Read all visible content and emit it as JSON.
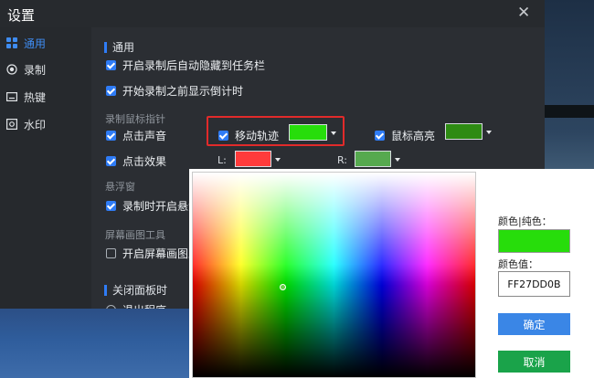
{
  "window": {
    "title": "设置",
    "close_glyph": "✕"
  },
  "sidebar": {
    "items": [
      {
        "label": "通用",
        "icon": "grid-icon",
        "active": true
      },
      {
        "label": "录制",
        "icon": "record-icon",
        "active": false
      },
      {
        "label": "热键",
        "icon": "keyboard-icon",
        "active": false
      },
      {
        "label": "水印",
        "icon": "watermark-icon",
        "active": false
      }
    ]
  },
  "general": {
    "section_title": "通用",
    "auto_hide": "开启录制后自动隐藏到任务栏",
    "countdown": "开始录制之前显示倒计时"
  },
  "mouse": {
    "group_title": "录制鼠标指针",
    "click_sound": "点击声音",
    "move_track": "移动轨迹",
    "highlight": "鼠标高亮",
    "click_effect": "点击效果",
    "left_label": "L:",
    "right_label": "R:"
  },
  "floating": {
    "group_title": "悬浮窗",
    "option": "录制时开启悬浮"
  },
  "drawing": {
    "group_title": "屏幕画图工具",
    "option": "开启屏幕画图工"
  },
  "close_panel": {
    "section_title": "关闭面板时",
    "option": "退出程序"
  },
  "colors": {
    "accent": "#2f7cf6",
    "move_track_swatch": "#27dd0b",
    "highlight_swatch": "#2e8b13",
    "left_click_swatch": "#ff3b3b",
    "right_click_swatch": "#56a94f"
  },
  "color_picker": {
    "pure_color_label": "颜色|纯色：",
    "value_label": "颜色值：",
    "hex_value": "FF27DD0B",
    "preview_color": "#27dd0b",
    "confirm": "确定",
    "cancel": "取消",
    "confirm_color": "#3a86e6",
    "cancel_color": "#1aa34a"
  }
}
